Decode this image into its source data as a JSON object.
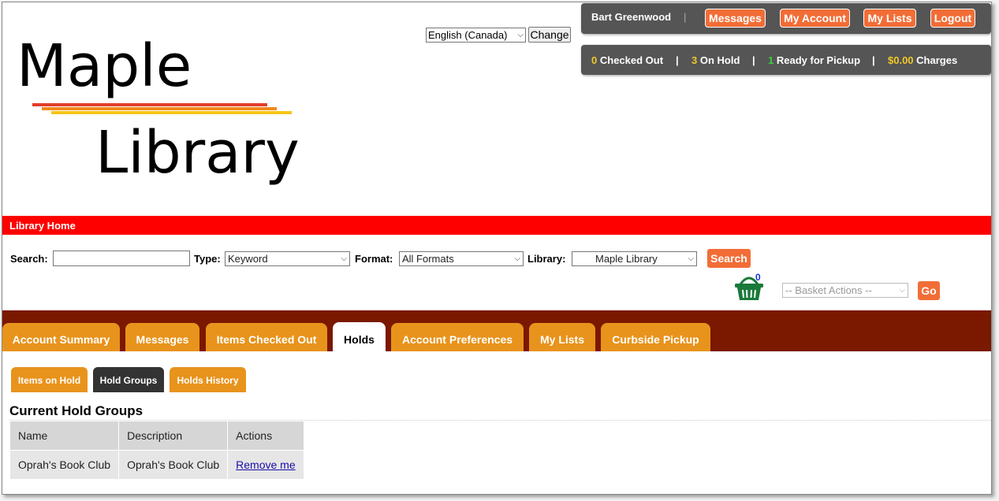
{
  "language": {
    "selected": "English (Canada)",
    "change_label": "Change"
  },
  "userbar": {
    "user_name": "Bart Greenwood",
    "separator": "|",
    "buttons": [
      "Messages",
      "My Account",
      "My Lists",
      "Logout"
    ]
  },
  "statusbar": {
    "checked_out": {
      "count": "0",
      "label": "Checked Out"
    },
    "on_hold": {
      "count": "3",
      "label": "On Hold"
    },
    "ready": {
      "count": "1",
      "label": "Ready for Pickup"
    },
    "charges": {
      "amount": "$0.00",
      "label": "Charges"
    }
  },
  "logo": {
    "line1": "Maple",
    "line2": "Library",
    "stripe_colors": [
      "#e23d2a",
      "#f0891c",
      "#f5c518"
    ]
  },
  "nav": {
    "home_link": "Library Home"
  },
  "search": {
    "search_label": "Search:",
    "search_value": "",
    "type_label": "Type:",
    "type_value": "Keyword",
    "format_label": "Format:",
    "format_value": "All Formats",
    "library_label": "Library:",
    "library_value": "Maple Library",
    "search_button": "Search"
  },
  "basket": {
    "count": "0",
    "actions_placeholder": "-- Basket Actions --",
    "go_label": "Go"
  },
  "tabs": [
    {
      "label": "Account Summary",
      "active": false
    },
    {
      "label": "Messages",
      "active": false
    },
    {
      "label": "Items Checked Out",
      "active": false
    },
    {
      "label": "Holds",
      "active": true
    },
    {
      "label": "Account Preferences",
      "active": false
    },
    {
      "label": "My Lists",
      "active": false
    },
    {
      "label": "Curbside Pickup",
      "active": false
    }
  ],
  "subtabs": [
    {
      "label": "Items on Hold",
      "active": false
    },
    {
      "label": "Hold Groups",
      "active": true
    },
    {
      "label": "Holds History",
      "active": false
    }
  ],
  "hold_groups": {
    "title": "Current Hold Groups",
    "columns": [
      "Name",
      "Description",
      "Actions"
    ],
    "rows": [
      {
        "name": "Oprah's Book Club",
        "description": "Oprah's Book Club",
        "action": "Remove me"
      }
    ]
  },
  "colors": {
    "accent_orange": "#f26d36",
    "tab_orange": "#e8931c",
    "tab_bar_dark_red": "#7a1800",
    "nav_red": "#ff0000",
    "user_bar_gray": "#555555"
  }
}
